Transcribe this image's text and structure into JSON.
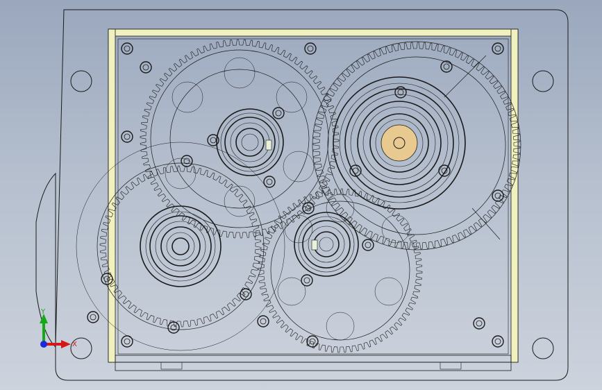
{
  "viewport": {
    "background_top": "#9aa7bd",
    "background_bottom": "#cdd3dd",
    "line_color": "#1a1a1a",
    "housing_rim_color": "#f1f1bf",
    "hub_highlight_color": "#e8c98f"
  },
  "triad": {
    "y_label": "Y",
    "x_label": "X",
    "y_color": "#17a81a",
    "x_color": "#d41818",
    "z_color": "#1c2ad8"
  }
}
